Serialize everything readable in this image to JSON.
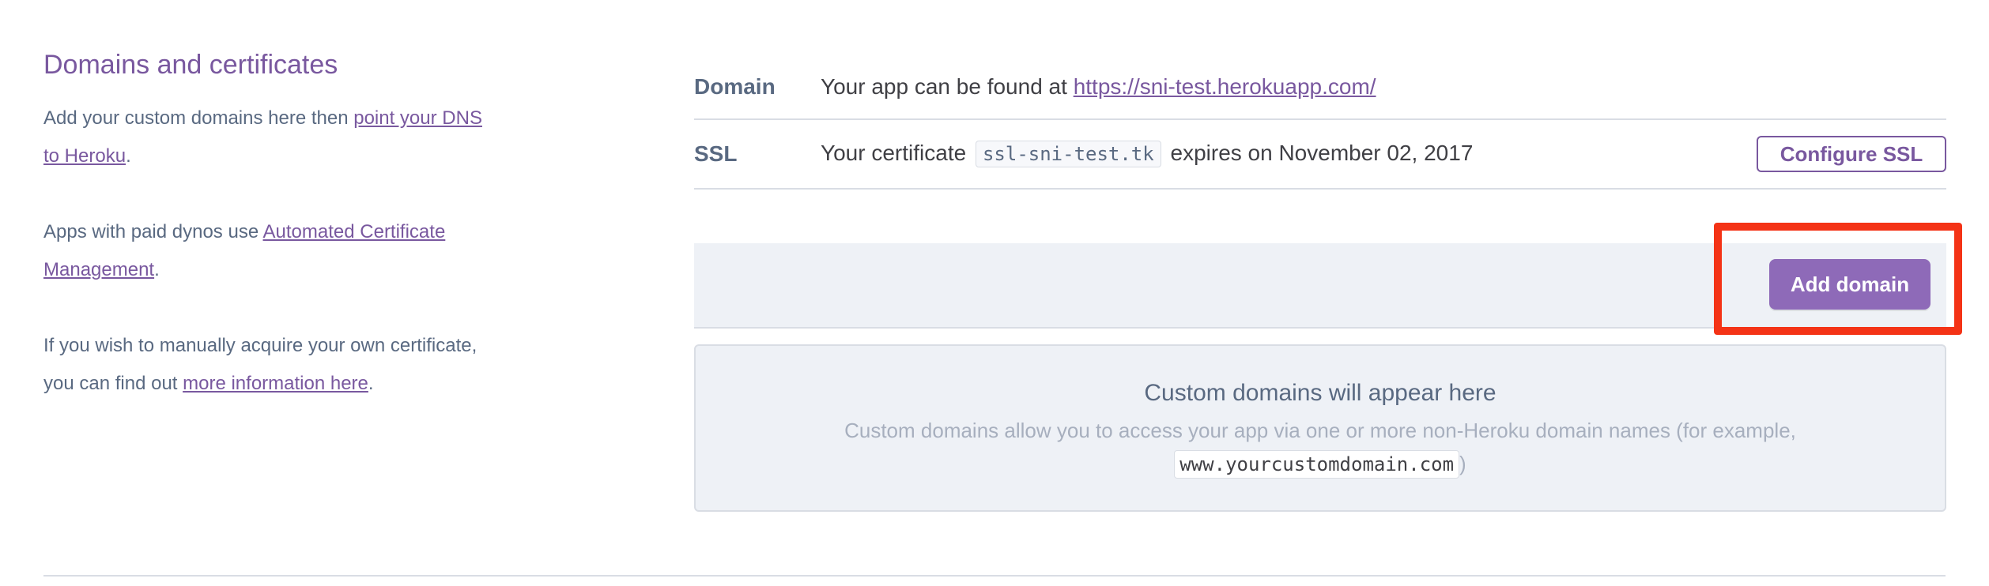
{
  "sidebar": {
    "title": "Domains and certificates",
    "p1_text": "Add your custom domains here then ",
    "p1_link": "point your DNS to Heroku",
    "p1_end": ".",
    "p2_text": "Apps with paid dynos use ",
    "p2_link": "Automated Certificate Management",
    "p2_end": ".",
    "p3_text": "If you wish to manually acquire your own certificate, you can find out ",
    "p3_link": "more information here",
    "p3_end": "."
  },
  "domain_row": {
    "label": "Domain",
    "text": "Your app can be found at ",
    "url": "https://sni-test.herokuapp.com/"
  },
  "ssl_row": {
    "label": "SSL",
    "text_before": "Your certificate",
    "cert_name": "ssl-sni-test.tk",
    "text_after": "expires on November 02, 2017",
    "button": "Configure SSL"
  },
  "toolbar": {
    "add_domain": "Add domain"
  },
  "empty_state": {
    "title": "Custom domains will appear here",
    "desc_before": "Custom domains allow you to access your app via one or more non-Heroku domain names (for example,",
    "example": "www.yourcustomdomain.com",
    "desc_after": ")"
  },
  "colors": {
    "accent": "#79589f",
    "button_fill": "#8e6ab8",
    "highlight": "#f43316",
    "panel": "#eef1f6"
  }
}
